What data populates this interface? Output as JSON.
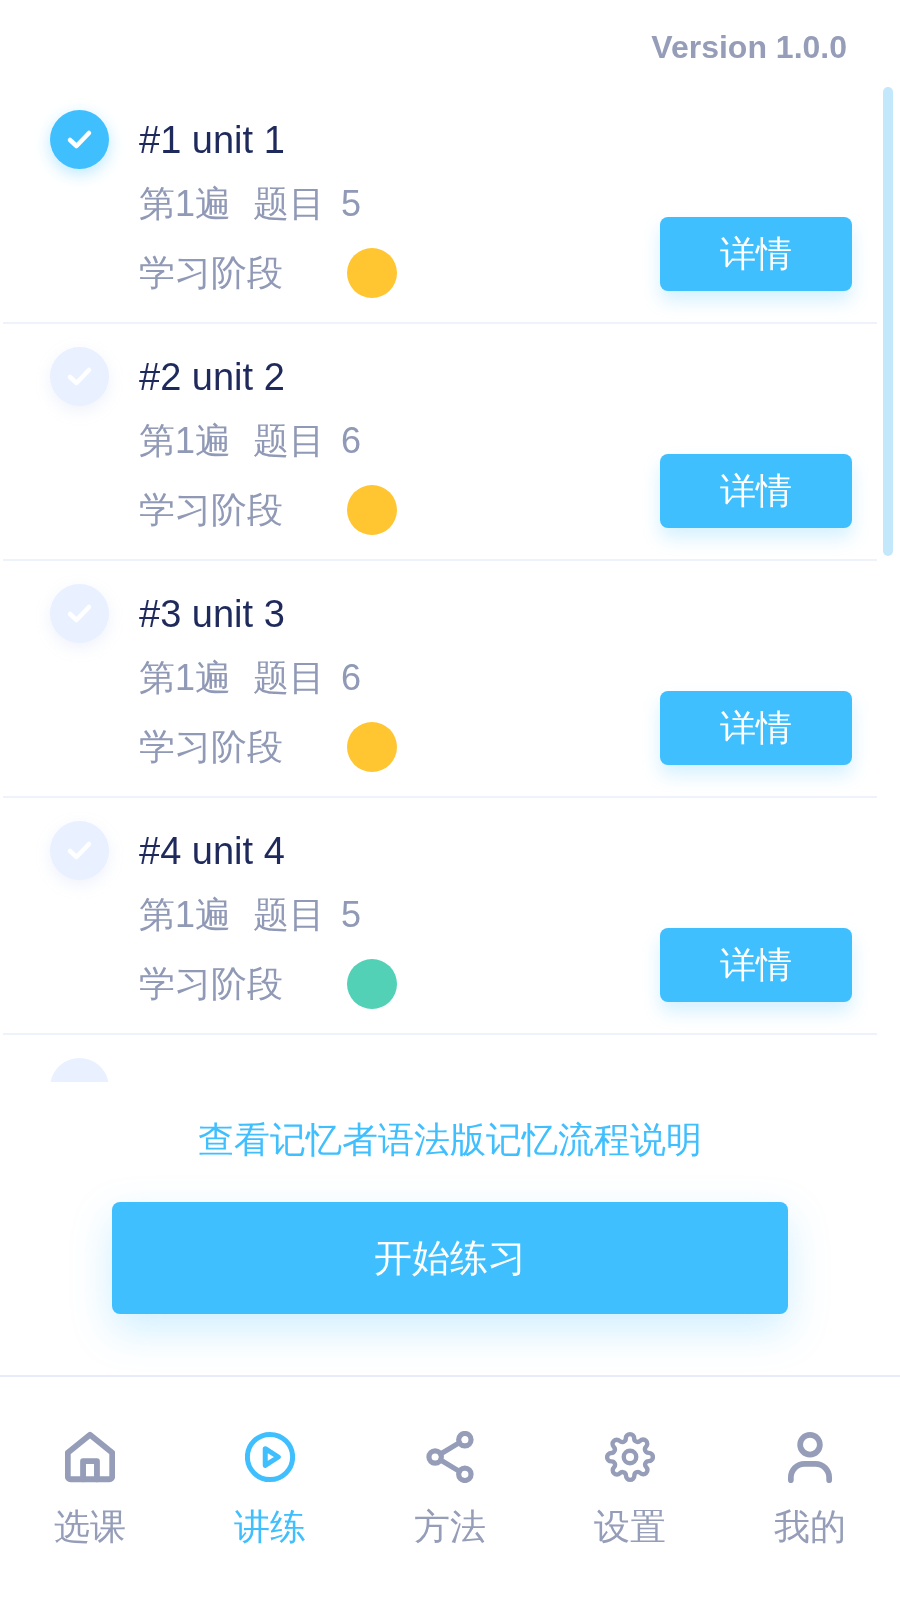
{
  "version": "Version 1.0.0",
  "units": [
    {
      "checked": true,
      "title": "#1 unit 1",
      "round": "第1遍",
      "questions_label": "题目",
      "questions_count": "5",
      "stage_label": "学习阶段",
      "color": "#ffc632",
      "button": "详情"
    },
    {
      "checked": false,
      "title": "#2 unit 2",
      "round": "第1遍",
      "questions_label": "题目",
      "questions_count": "6",
      "stage_label": "学习阶段",
      "color": "#ffc632",
      "button": "详情"
    },
    {
      "checked": false,
      "title": "#3 unit 3",
      "round": "第1遍",
      "questions_label": "题目",
      "questions_count": "6",
      "stage_label": "学习阶段",
      "color": "#ffc632",
      "button": "详情"
    },
    {
      "checked": false,
      "title": "#4 unit 4",
      "round": "第1遍",
      "questions_label": "题目",
      "questions_count": "5",
      "stage_label": "学习阶段",
      "color": "#52d1b6",
      "button": "详情"
    }
  ],
  "partial_unit": {
    "checked": false
  },
  "guide_link": "查看记忆者语法版记忆流程说明",
  "start_button": "开始练习",
  "tabs": [
    {
      "label": "选课",
      "selected": false
    },
    {
      "label": "讲练",
      "selected": true
    },
    {
      "label": "方法",
      "selected": false
    },
    {
      "label": "设置",
      "selected": false
    },
    {
      "label": "我的",
      "selected": false
    }
  ]
}
